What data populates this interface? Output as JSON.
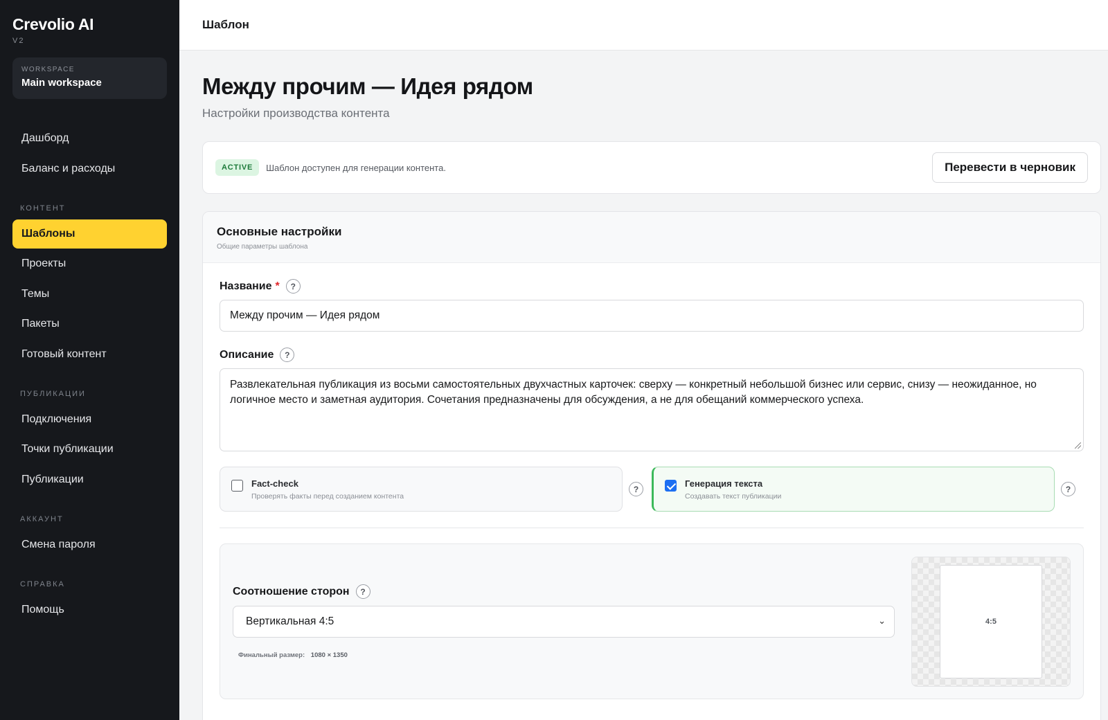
{
  "app": {
    "name": "Crevolio AI",
    "version": "V2"
  },
  "workspace": {
    "label": "WORKSPACE",
    "name": "Main workspace"
  },
  "sidebar": {
    "top_items": [
      {
        "label": "Дашборд"
      },
      {
        "label": "Баланс и расходы"
      }
    ],
    "sections": [
      {
        "title": "КОНТЕНТ",
        "items": [
          {
            "label": "Шаблоны",
            "active": true
          },
          {
            "label": "Проекты"
          },
          {
            "label": "Темы"
          },
          {
            "label": "Пакеты"
          },
          {
            "label": "Готовый контент"
          }
        ]
      },
      {
        "title": "ПУБЛИКАЦИИ",
        "items": [
          {
            "label": "Подключения"
          },
          {
            "label": "Точки публикации"
          },
          {
            "label": "Публикации"
          }
        ]
      },
      {
        "title": "АККАУНТ",
        "items": [
          {
            "label": "Смена пароля"
          }
        ]
      },
      {
        "title": "СПРАВКА",
        "items": [
          {
            "label": "Помощь"
          }
        ]
      }
    ]
  },
  "topbar": {
    "breadcrumb": "Шаблон"
  },
  "page": {
    "title": "Между прочим — Идея рядом",
    "subtitle": "Настройки производства контента"
  },
  "status": {
    "badge": "ACTIVE",
    "text": "Шаблон доступен для генерации контента.",
    "action_label": "Перевести в черновик",
    "badge_color": "#1d7a3a"
  },
  "settings": {
    "title": "Основные настройки",
    "subtitle": "Общие параметры шаблона",
    "name_label": "Название",
    "required_mark": "*",
    "name_value": "Между прочим — Идея рядом",
    "description_label": "Описание",
    "description_value": "Развлекательная публикация из восьми самостоятельных двухчастных карточек: сверху — конкретный небольшой бизнес или сервис, снизу — неожиданное, но логичное место и заметная аудитория. Сочетания предназначены для обсуждения, а не для обещаний коммерческого успеха.",
    "help_glyph": "?",
    "fact_check": {
      "title": "Fact-check",
      "description": "Проверять факты перед созданием контента",
      "checked": false
    },
    "text_generation": {
      "title": "Генерация текста",
      "description": "Создавать текст публикации",
      "checked": true
    },
    "aspect": {
      "label": "Соотношение сторон",
      "selected": "Вертикальная 4:5",
      "final_size_label": "Финальный размер:",
      "final_size_value": "1080 × 1350",
      "preview_label": "4:5"
    }
  },
  "colors": {
    "sidebar_bg": "#16181c",
    "accent": "#ffd230",
    "checkbox": "#1d6ff2",
    "toggle_on_border": "#3cb95a"
  }
}
